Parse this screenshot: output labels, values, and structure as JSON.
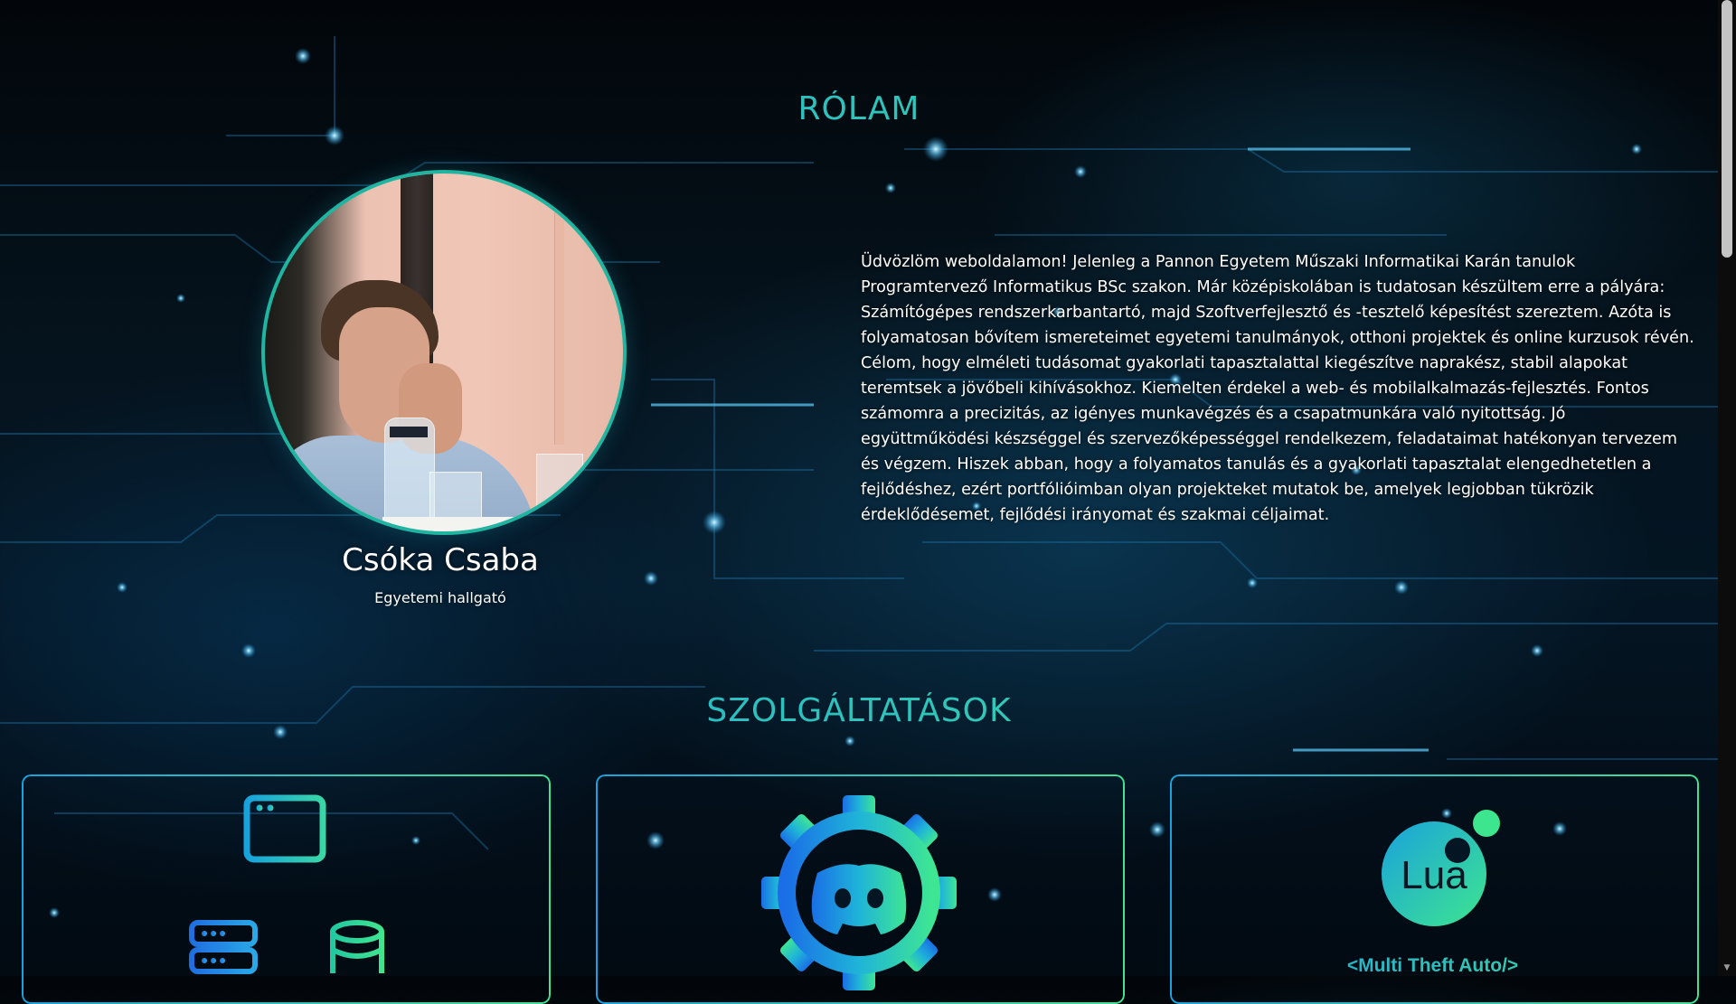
{
  "about": {
    "title": "RÓLAM",
    "name": "Csóka Csaba",
    "role": "Egyetemi hallgató",
    "text": "Üdvözlöm weboldalamon! Jelenleg a Pannon Egyetem Műszaki Informatikai Karán tanulok Programtervező Informatikus BSc szakon. Már középiskolában is tudatosan készültem erre a pályára: Számítógépes rendszerkarbantartó, majd Szoftverfejlesztő és -tesztelő képesítést szereztem. Azóta is folyamatosan bővítem ismereteimet egyetemi tanulmányok, otthoni projektek és online kurzusok révén. Célom, hogy elméleti tudásomat gyakorlati tapasztalattal kiegészítve naprakész, stabil alapokat teremtsek a jövőbeli kihívásokhoz. Kiemelten érdekel a web- és mobilalkalmazás-fejlesztés. Fontos számomra a precizitás, az igényes munkavégzés és a csapatmunkára való nyitottság. Jó együttműködési készséggel és szervezőképességgel rendelkezem, feladataimat hatékonyan tervezem és végzem. Hiszek abban, hogy a folyamatos tanulás és a gyakorlati tapasztalat elengedhetetlen a fejlődéshez, ezért portfólióimban olyan projekteket mutatok be, amelyek legjobban tükrözik érdeklődésemet, fejlődési irányomat és szakmai céljaimat."
  },
  "services": {
    "title": "SZOLGÁLTATÁSOK",
    "cards": [
      {
        "icons": [
          "browser-window-icon",
          "server-icon",
          "database-icon"
        ]
      },
      {
        "icons": [
          "discord-gear-icon"
        ]
      },
      {
        "icons": [
          "lua-logo-icon"
        ],
        "label": "<Multi Theft Auto/>",
        "logo_text": "Lua"
      }
    ]
  },
  "colors": {
    "accent_blue": "#1aa7dc",
    "accent_green": "#3ee09a",
    "text": "#ffffff"
  }
}
